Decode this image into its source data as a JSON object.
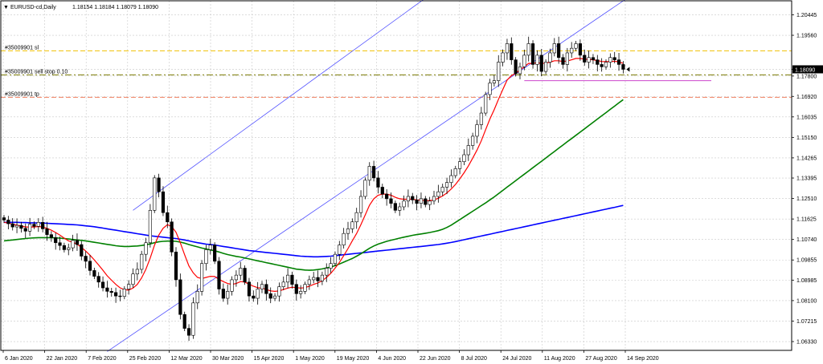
{
  "header": {
    "symbol": "EURUSD-cd,Daily",
    "ohlc": "1.18154 1.18184 1.18079 1.18090",
    "marker": "▼"
  },
  "colors": {
    "background": "#ffffff",
    "grid": "#c8c8c8",
    "candle_up_body": "#ffffff",
    "candle_down_body": "#000000",
    "candle_border": "#000000",
    "ma_fast": "#ff0000",
    "ma_fast_light": "#f0c040",
    "ma_mid": "#008000",
    "ma_slow": "#0000ff",
    "channel": "#5050ff",
    "sl_line": "#f0c000",
    "sellstop_line": "#7a7a00",
    "tp_line": "#f08060",
    "magenta_line": "#cc44cc",
    "price_tag": "#000000",
    "price_tag_text": "#ffffff"
  },
  "chart_data": {
    "type": "candlestick",
    "title": "EURUSD-cd,Daily",
    "y_ticks": [
      "1.20445",
      "1.19560",
      "1.18090",
      "1.17800",
      "1.16920",
      "1.16035",
      "1.15150",
      "1.14265",
      "1.13395",
      "1.12510",
      "1.11625",
      "1.10740",
      "1.09855",
      "1.08985",
      "1.08100",
      "1.07215",
      "1.06330"
    ],
    "current_price": "1.18090",
    "ylim": [
      1.0595,
      1.2105
    ],
    "x_ticks": [
      "6 Jan 2020",
      "22 Jan 2020",
      "7 Feb 2020",
      "25 Feb 2020",
      "12 Mar 2020",
      "30 Mar 2020",
      "15 Apr 2020",
      "1 May 2020",
      "19 May 2020",
      "4 Jun 2020",
      "22 Jun 2020",
      "8 Jul 2020",
      "24 Jul 2020",
      "11 Aug 2020",
      "27 Aug 2020",
      "14 Sep 2020"
    ],
    "closes": [
      1.1158,
      1.1142,
      1.1128,
      1.1135,
      1.1122,
      1.111,
      1.114,
      1.1131,
      1.1148,
      1.112,
      1.1095,
      1.1082,
      1.106,
      1.1048,
      1.103,
      1.1038,
      1.107,
      1.1052,
      1.1002,
      1.098,
      1.094,
      1.0915,
      1.089,
      1.0865,
      1.085,
      1.0845,
      1.083,
      1.0828,
      1.086,
      1.088,
      1.0925,
      1.0945,
      1.101,
      1.106,
      1.12,
      1.134,
      1.128,
      1.119,
      1.115,
      1.102,
      1.09,
      1.075,
      1.069,
      1.066,
      1.08,
      1.085,
      1.097,
      1.103,
      1.105,
      1.098,
      1.086,
      1.082,
      1.085,
      1.09,
      1.092,
      1.095,
      1.089,
      1.083,
      1.082,
      1.086,
      1.088,
      1.084,
      1.082,
      1.083,
      1.087,
      1.089,
      1.092,
      1.088,
      1.084,
      1.085,
      1.088,
      1.09,
      1.091,
      1.0895,
      1.092,
      1.095,
      1.097,
      1.101,
      1.105,
      1.11,
      1.112,
      1.115,
      1.119,
      1.126,
      1.133,
      1.139,
      1.134,
      1.13,
      1.127,
      1.125,
      1.123,
      1.12,
      1.1215,
      1.124,
      1.126,
      1.1245,
      1.123,
      1.125,
      1.1225,
      1.124,
      1.126,
      1.128,
      1.13,
      1.132,
      1.135,
      1.138,
      1.141,
      1.144,
      1.148,
      1.152,
      1.157,
      1.162,
      1.17,
      1.175,
      1.176,
      1.184,
      1.188,
      1.192,
      1.185,
      1.179,
      1.182,
      1.187,
      1.192,
      1.183,
      1.187,
      1.18,
      1.184,
      1.188,
      1.192,
      1.186,
      1.183,
      1.188,
      1.19,
      1.192,
      1.187,
      1.184,
      1.186,
      1.185,
      1.183,
      1.182,
      1.184,
      1.186,
      1.185,
      1.183,
      1.1809
    ],
    "ma_fast": [
      1.1148,
      1.1145,
      1.114,
      1.1136,
      1.1132,
      1.1128,
      1.1128,
      1.1128,
      1.113,
      1.1128,
      1.1122,
      1.1114,
      1.1104,
      1.1093,
      1.108,
      1.1068,
      1.1062,
      1.1054,
      1.104,
      1.1024,
      1.1006,
      1.0986,
      1.0964,
      1.0941,
      1.0917,
      1.0898,
      1.088,
      1.0865,
      1.0857,
      1.0855,
      1.0864,
      1.088,
      1.0908,
      1.0945,
      1.0994,
      1.105,
      1.1093,
      1.1122,
      1.1138,
      1.113,
      1.1105,
      1.106,
      1.1008,
      1.096,
      1.093,
      1.091,
      1.0905,
      1.091,
      1.0915,
      1.0914,
      1.0902,
      1.0892,
      1.0884,
      1.088,
      1.0884,
      1.0892,
      1.089,
      1.0881,
      1.0872,
      1.0866,
      1.0864,
      1.0858,
      1.0852,
      1.085,
      1.0852,
      1.0858,
      1.0864,
      1.0868,
      1.0866,
      1.0864,
      1.0866,
      1.0872,
      1.088,
      1.0886,
      1.0896,
      1.091,
      1.0928,
      1.095,
      1.0975,
      1.1004,
      1.1035,
      1.1068,
      1.11,
      1.1138,
      1.118,
      1.1222,
      1.125,
      1.1265,
      1.127,
      1.127,
      1.1265,
      1.1256,
      1.125,
      1.1248,
      1.1248,
      1.1248,
      1.1245,
      1.1244,
      1.1242,
      1.1242,
      1.1245,
      1.1252,
      1.1262,
      1.1275,
      1.1292,
      1.1312,
      1.1336,
      1.1362,
      1.1392,
      1.1425,
      1.146,
      1.15,
      1.1548,
      1.1594,
      1.1635,
      1.168,
      1.1722,
      1.1762,
      1.1782,
      1.1792,
      1.1806,
      1.182,
      1.1835,
      1.1834,
      1.1838,
      1.1834,
      1.1836,
      1.184,
      1.1846,
      1.1846,
      1.1843,
      1.1845,
      1.185,
      1.1856,
      1.1856,
      1.1853,
      1.1852,
      1.185,
      1.1847,
      1.1843,
      1.1842,
      1.1843,
      1.1844,
      1.1841,
      1.1835
    ],
    "ma_mid": [
      1.1068,
      1.107,
      1.1072,
      1.1074,
      1.1076,
      1.1078,
      1.108,
      1.1081,
      1.1082,
      1.1082,
      1.1082,
      1.1082,
      1.1081,
      1.108,
      1.1078,
      1.1076,
      1.1074,
      1.1072,
      1.107,
      1.1068,
      1.1065,
      1.1062,
      1.1059,
      1.1056,
      1.1053,
      1.105,
      1.1047,
      1.1045,
      1.1044,
      1.1044,
      1.1045,
      1.1046,
      1.1048,
      1.1051,
      1.1055,
      1.106,
      1.1064,
      1.1066,
      1.1067,
      1.1067,
      1.1066,
      1.1063,
      1.1058,
      1.1052,
      1.1047,
      1.1042,
      1.1037,
      1.1033,
      1.1029,
      1.1025,
      1.102,
      1.1014,
      1.1009,
      1.1005,
      1.1001,
      1.0998,
      1.0994,
      1.099,
      1.0986,
      1.0982,
      1.0978,
      1.0974,
      1.097,
      1.0966,
      1.0962,
      1.0958,
      1.0954,
      1.095,
      1.0946,
      1.0944,
      1.0942,
      1.0941,
      1.0942,
      1.0944,
      1.0947,
      1.0951,
      1.0955,
      1.0961,
      1.0968,
      1.0976,
      1.0984,
      1.0992,
      1.1002,
      1.1012,
      1.1024,
      1.1036,
      1.1046,
      1.1054,
      1.106,
      1.1066,
      1.1071,
      1.1075,
      1.108,
      1.1084,
      1.1088,
      1.1092,
      1.1095,
      1.1098,
      1.1101,
      1.1104,
      1.1108,
      1.1112,
      1.1118,
      1.1126,
      1.1136,
      1.1148,
      1.116,
      1.1172,
      1.1184,
      1.1196,
      1.1208,
      1.122,
      1.1232,
      1.1245,
      1.1258,
      1.1272,
      1.1286,
      1.13,
      1.1314,
      1.1328,
      1.1342,
      1.1356,
      1.137,
      1.1384,
      1.1398,
      1.1412,
      1.1426,
      1.144,
      1.1454,
      1.1468,
      1.1482,
      1.1496,
      1.151,
      1.1524,
      1.1538,
      1.1552,
      1.1566,
      1.158,
      1.1594,
      1.1608,
      1.1622,
      1.1636,
      1.165,
      1.1664,
      1.1678
    ],
    "ma_slow": [
      1.1148,
      1.1148,
      1.1148,
      1.1148,
      1.1147,
      1.1147,
      1.1146,
      1.1146,
      1.1145,
      1.1145,
      1.1144,
      1.1143,
      1.1142,
      1.1141,
      1.114,
      1.1139,
      1.1138,
      1.1137,
      1.1135,
      1.1133,
      1.1131,
      1.1129,
      1.1126,
      1.1123,
      1.112,
      1.1117,
      1.1114,
      1.1111,
      1.1108,
      1.1105,
      1.1102,
      1.1099,
      1.1096,
      1.1093,
      1.109,
      1.1088,
      1.1086,
      1.1084,
      1.1082,
      1.108,
      1.1078,
      1.1075,
      1.1072,
      1.1068,
      1.1064,
      1.106,
      1.1057,
      1.1054,
      1.1052,
      1.105,
      1.1047,
      1.1044,
      1.1041,
      1.1038,
      1.1035,
      1.1032,
      1.1029,
      1.1026,
      1.1024,
      1.1022,
      1.102,
      1.1018,
      1.1016,
      1.1014,
      1.1012,
      1.101,
      1.1008,
      1.1006,
      1.1004,
      1.1002,
      1.1001,
      1.1,
      1.0999,
      1.0999,
      1.1,
      1.1001,
      1.1002,
      1.1004,
      1.1006,
      1.1008,
      1.101,
      1.1012,
      1.1014,
      1.1016,
      1.1018,
      1.102,
      1.1022,
      1.1024,
      1.1026,
      1.1028,
      1.103,
      1.1032,
      1.1034,
      1.1036,
      1.1038,
      1.104,
      1.1042,
      1.1044,
      1.1046,
      1.1048,
      1.105,
      1.1052,
      1.1055,
      1.1058,
      1.1061,
      1.1065,
      1.1069,
      1.1073,
      1.1077,
      1.1081,
      1.1085,
      1.1089,
      1.1093,
      1.1097,
      1.1101,
      1.1105,
      1.1109,
      1.1113,
      1.1117,
      1.1121,
      1.1125,
      1.1129,
      1.1133,
      1.1137,
      1.1141,
      1.1145,
      1.1149,
      1.1153,
      1.1157,
      1.1161,
      1.1165,
      1.1169,
      1.1173,
      1.1177,
      1.1181,
      1.1185,
      1.1189,
      1.1193,
      1.1197,
      1.1201,
      1.1205,
      1.1209,
      1.1213,
      1.1217,
      1.1221
    ],
    "horizontal_lines": [
      {
        "label": "#35009901 sl",
        "price": 1.1889,
        "color_key": "sl_line"
      },
      {
        "label": "#35009901 sell stop 0.10",
        "price": 1.1785,
        "color_key": "sellstop_line"
      },
      {
        "label": "#35009901 tp",
        "price": 1.1688,
        "color_key": "tp_line"
      }
    ],
    "magenta_level": 1.176,
    "channel_upper": [
      [
        1.12,
        30
      ],
      [
        1.213,
        99
      ]
    ],
    "channel_lower": [
      [
        1.059,
        24
      ],
      [
        1.213,
        146
      ]
    ]
  }
}
